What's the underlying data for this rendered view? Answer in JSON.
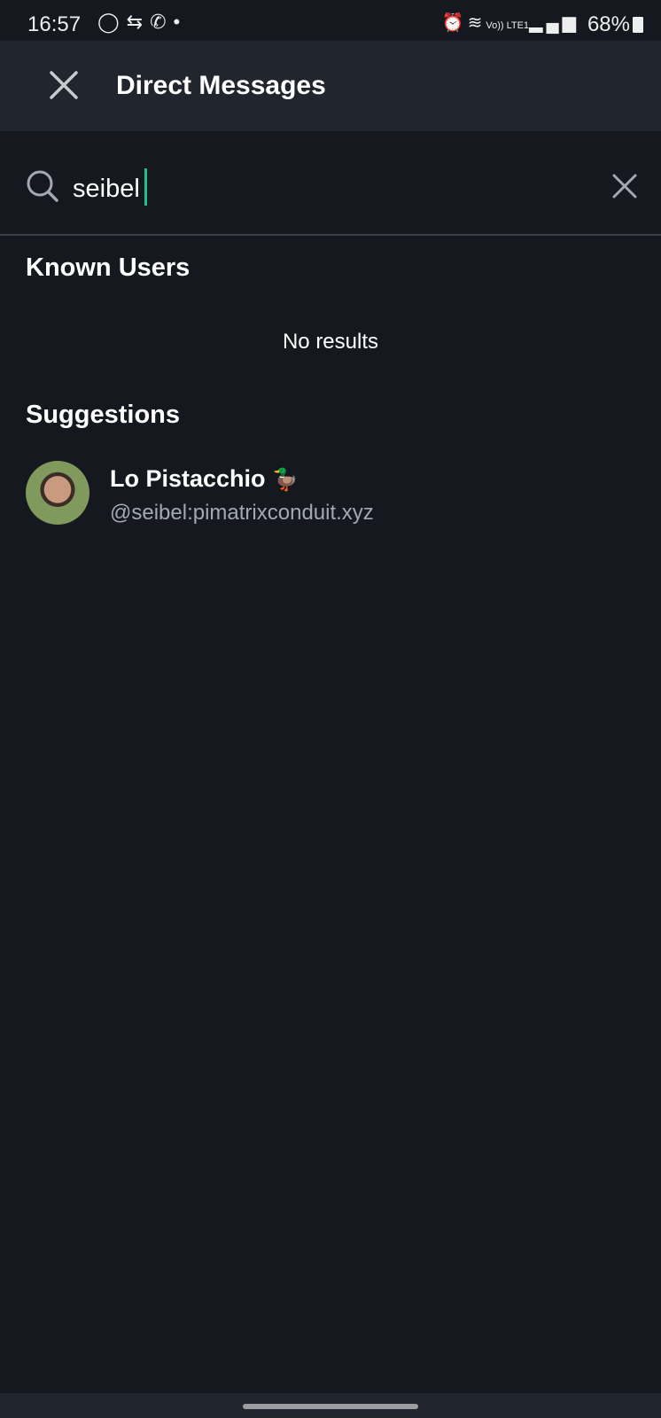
{
  "status_bar": {
    "time": "16:57",
    "left_icons": [
      "signal-app-icon",
      "data-transfer-icon",
      "whatsapp-icon",
      "dot-icon"
    ],
    "right_icons": [
      "alarm-icon",
      "wifi-icon",
      "volte-lte-icon",
      "cell-signal-icon"
    ],
    "volte": "Vo)) LTE1",
    "battery": "68%"
  },
  "header": {
    "title": "Direct Messages"
  },
  "search": {
    "value": "seibel"
  },
  "known_users": {
    "title": "Known Users",
    "empty": "No results"
  },
  "suggestions": {
    "title": "Suggestions",
    "items": [
      {
        "name": "Lo Pistacchio",
        "emoji": "🦆",
        "handle": "@seibel:pimatrixconduit.xyz"
      }
    ]
  },
  "colors": {
    "background": "#15181e",
    "header": "#21252d",
    "caret": "#1fbf8f"
  }
}
